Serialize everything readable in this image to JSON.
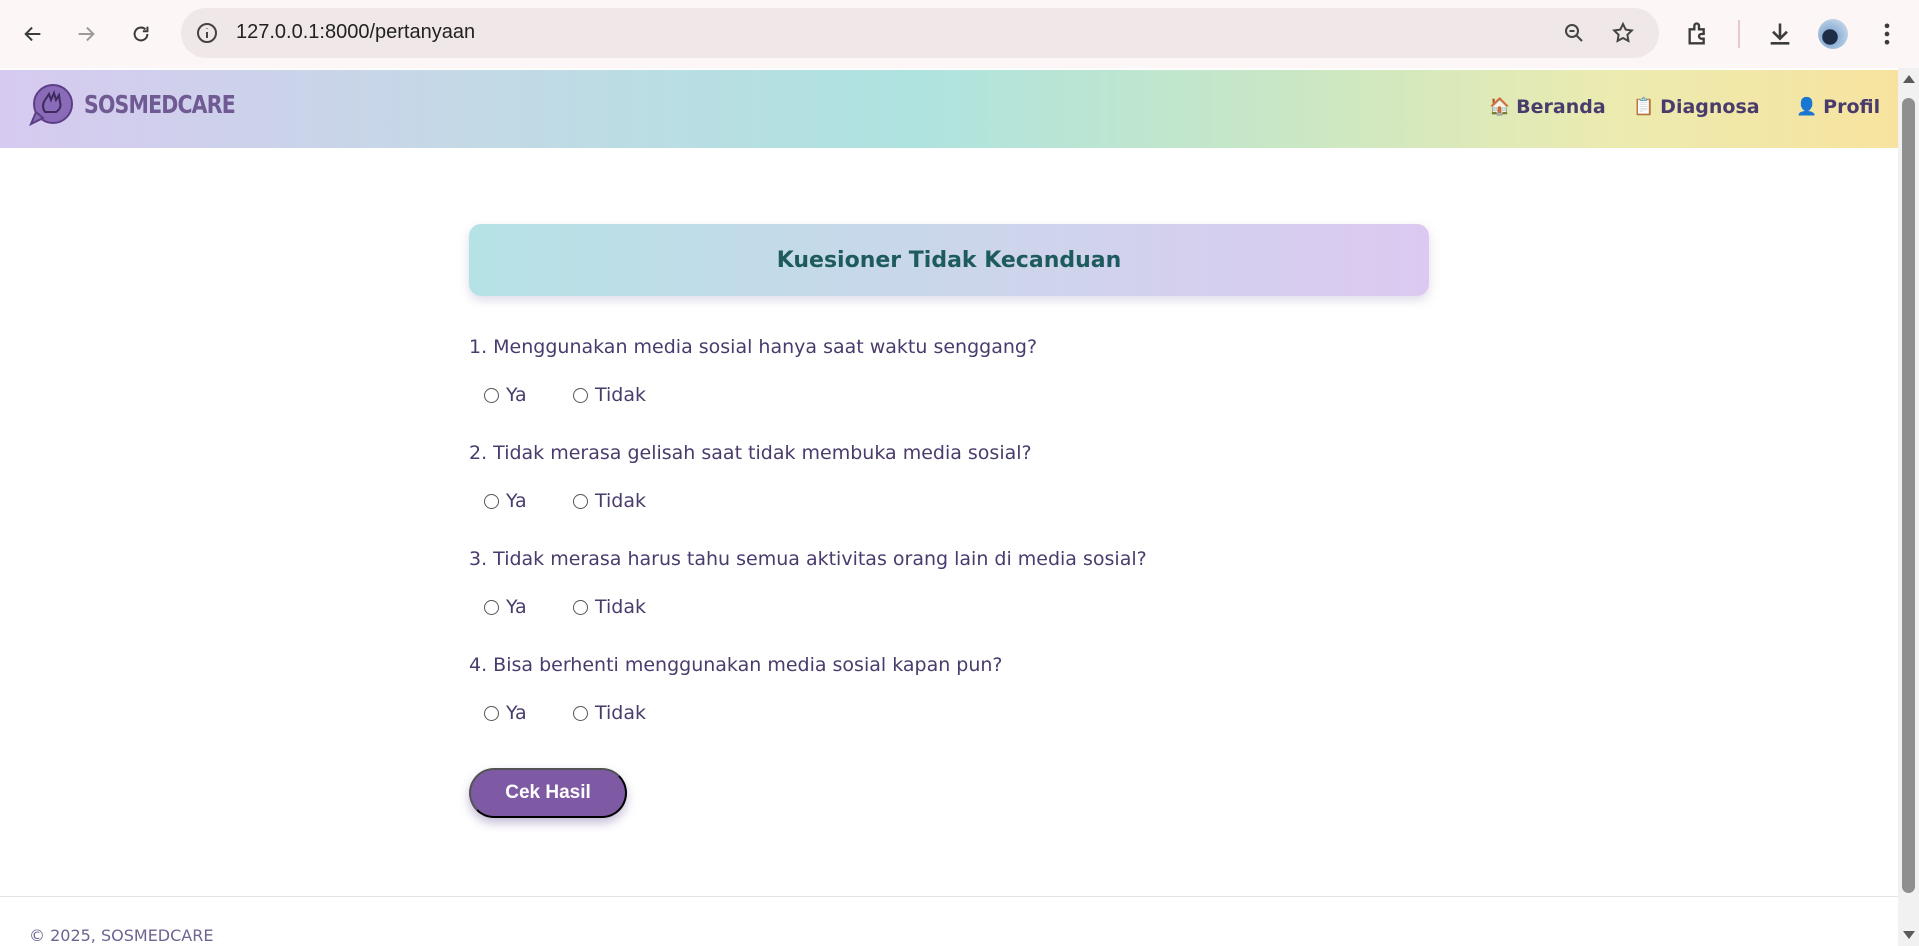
{
  "browser": {
    "url": "127.0.0.1:8000/pertanyaan"
  },
  "site": {
    "brand": "SOSMEDCARE",
    "nav": [
      {
        "icon": "🏠",
        "label": "Beranda"
      },
      {
        "icon": "📋",
        "label": "Diagnosa"
      },
      {
        "icon": "👤",
        "label": "Profil"
      }
    ]
  },
  "questionnaire": {
    "title": "Kuesioner Tidak Kecanduan",
    "questions": [
      {
        "text": "1. Menggunakan media sosial hanya saat waktu senggang?",
        "options": [
          "Ya",
          "Tidak"
        ]
      },
      {
        "text": "2. Tidak merasa gelisah saat tidak membuka media sosial?",
        "options": [
          "Ya",
          "Tidak"
        ]
      },
      {
        "text": "3. Tidak merasa harus tahu semua aktivitas orang lain di media sosial?",
        "options": [
          "Ya",
          "Tidak"
        ]
      },
      {
        "text": "4. Bisa berhenti menggunakan media sosial kapan pun?",
        "options": [
          "Ya",
          "Tidak"
        ]
      }
    ],
    "submit_label": "Cek Hasil"
  },
  "footer": {
    "text": "© 2025, SOSMEDCARE"
  },
  "colors": {
    "accent": "#7e5aa5",
    "text": "#4a3b6d",
    "title": "#1e5b5f"
  }
}
